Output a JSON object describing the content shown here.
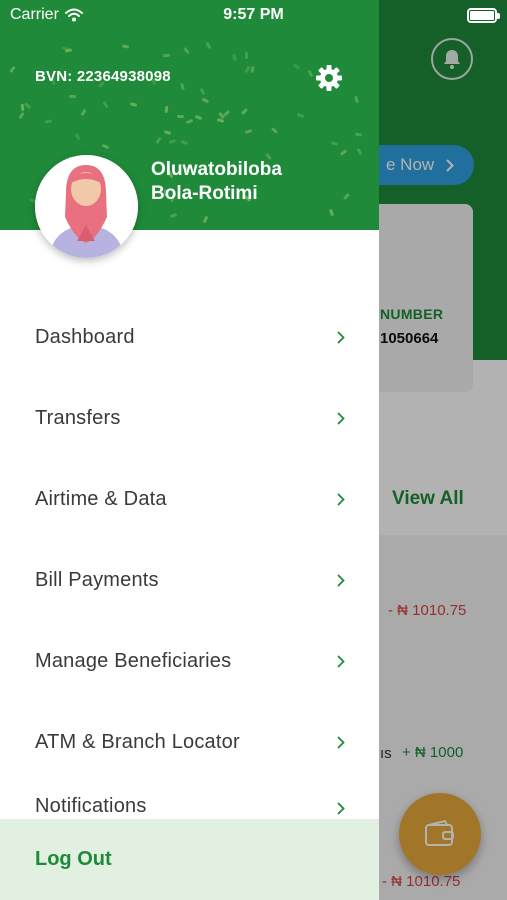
{
  "status_bar": {
    "carrier": "Carrier",
    "time": "9:57 PM",
    "battery_level": 1.0
  },
  "drawer": {
    "bvn": "BVN: 22364938098",
    "settings_icon": "gear-icon",
    "user": {
      "first_name": "Oluwatobiloba",
      "last_name": "Bola-Rotimi"
    },
    "menu_items": [
      {
        "label": "Dashboard",
        "icon": "chevron-right-icon"
      },
      {
        "label": "Transfers",
        "icon": "chevron-right-icon"
      },
      {
        "label": "Airtime & Data",
        "icon": "chevron-right-icon"
      },
      {
        "label": "Bill Payments",
        "icon": "chevron-right-icon"
      },
      {
        "label": "Manage Beneficiaries",
        "icon": "chevron-right-icon"
      },
      {
        "label": "ATM & Branch Locator",
        "icon": "chevron-right-icon"
      },
      {
        "label": "Notifications",
        "icon": "chevron-right-icon"
      }
    ],
    "logout_label": "Log Out"
  },
  "background": {
    "save_pill_label": "e Now",
    "account_label": "NUMBER",
    "account_value": "1050664",
    "view_all_label": "View All",
    "transactions": [
      {
        "amount": "- ₦ 1010.75",
        "type": "debit"
      },
      {
        "fragment": "ıs",
        "amount": "+ ₦ 1000",
        "type": "credit"
      },
      {
        "amount": "- ₦ 1010.75",
        "type": "debit"
      }
    ]
  },
  "colors": {
    "brand_green": "#1f8a3a",
    "logout_bg": "#e1f0e1",
    "fab_orange": "#e8a93c",
    "debit_red": "#d94444"
  }
}
